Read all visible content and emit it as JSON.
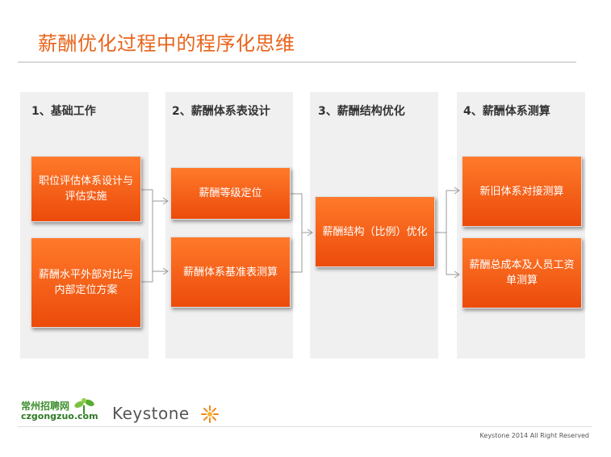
{
  "slide": {
    "title": "薪酬优化过程中的程序化思维",
    "footer": "Keystone 2014 All Right Reserved"
  },
  "columns": [
    {
      "header": "1、基础工作",
      "boxes": [
        "职位评估体系设计与评估实施",
        "薪酬水平外部对比与内部定位方案"
      ]
    },
    {
      "header": "2、薪酬体系表设计",
      "boxes": [
        "薪酬等级定位",
        "薪酬体系基准表测算"
      ]
    },
    {
      "header": "3、薪酬结构优化",
      "boxes": [
        "薪酬结构（比例）优化"
      ]
    },
    {
      "header": "4、薪酬体系测算",
      "boxes": [
        "新旧体系对接测算",
        "薪酬总成本及人员工资单测算"
      ]
    }
  ],
  "logos": {
    "cz_top": "常州招聘网",
    "cz_bottom": "czgongzuo.com",
    "keystone": "Keystone"
  },
  "colors": {
    "accent": "#e8641b",
    "box_fill": "#f25a14",
    "column_bg": "#f0f0f0"
  },
  "icons": [
    "sprout-icon",
    "sun-icon"
  ]
}
